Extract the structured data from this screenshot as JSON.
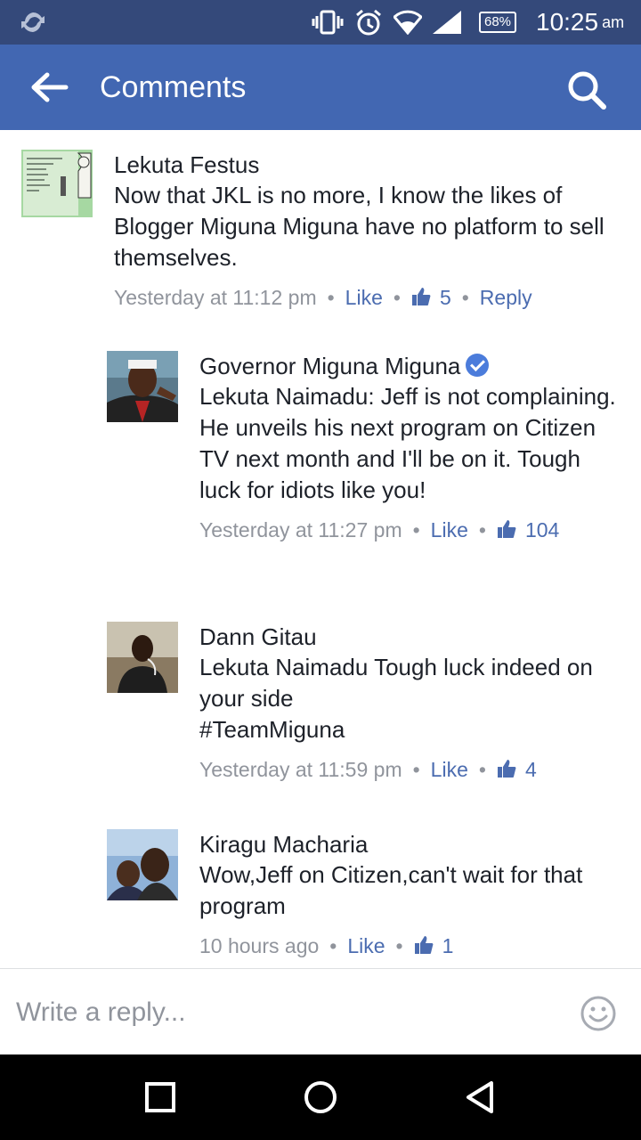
{
  "status_bar": {
    "battery": "68%",
    "time": "10:25",
    "ampm": "am",
    "icons": [
      "sync-icon",
      "vibrate-icon",
      "alarm-icon",
      "wifi-icon",
      "signal-icon",
      "battery-icon"
    ]
  },
  "app_bar": {
    "title": "Comments",
    "back_icon": "arrow-left-icon",
    "search_icon": "search-icon",
    "color": "#4267b2"
  },
  "comments": [
    {
      "author": "Lekuta Festus",
      "text": "Now that JKL is no more, I know the likes of Blogger Miguna Miguna have no platform to sell themselves.",
      "time": "Yesterday at 11:12 pm",
      "like_label": "Like",
      "likes": "5",
      "reply_label": "Reply",
      "avatar_text": "hanging my name to \"Nobody\" acebook, so n I see stupid people post like it and it ay \"Nobody this\"."
    },
    {
      "author": "Governor Miguna Miguna",
      "verified": true,
      "text": "Lekuta Naimadu: Jeff is not complaining. He unveils his next program on Citizen TV next month and I'll be on it. Tough luck for idiots like you!",
      "time": "Yesterday at 11:27 pm",
      "like_label": "Like",
      "likes": "104"
    },
    {
      "author": "Dann Gitau",
      "text_lines": [
        "Lekuta Naimadu Tough luck indeed on your side",
        "#TeamMiguna"
      ],
      "time": "Yesterday at 11:59 pm",
      "like_label": "Like",
      "likes": "4"
    },
    {
      "author": "Kiragu Macharia",
      "text": "Wow,Jeff on Citizen,can't wait for that program",
      "time": "10 hours ago",
      "like_label": "Like",
      "likes": "1"
    }
  ],
  "reply_input": {
    "placeholder": "Write a reply...",
    "emoji_icon": "smiley-icon"
  },
  "nav_bar": {
    "icons": [
      "recents-square-icon",
      "home-circle-icon",
      "back-triangle-icon"
    ]
  },
  "colors": {
    "status_bar": "#34497a",
    "link": "#4b6cb0",
    "meta": "#90949c"
  }
}
